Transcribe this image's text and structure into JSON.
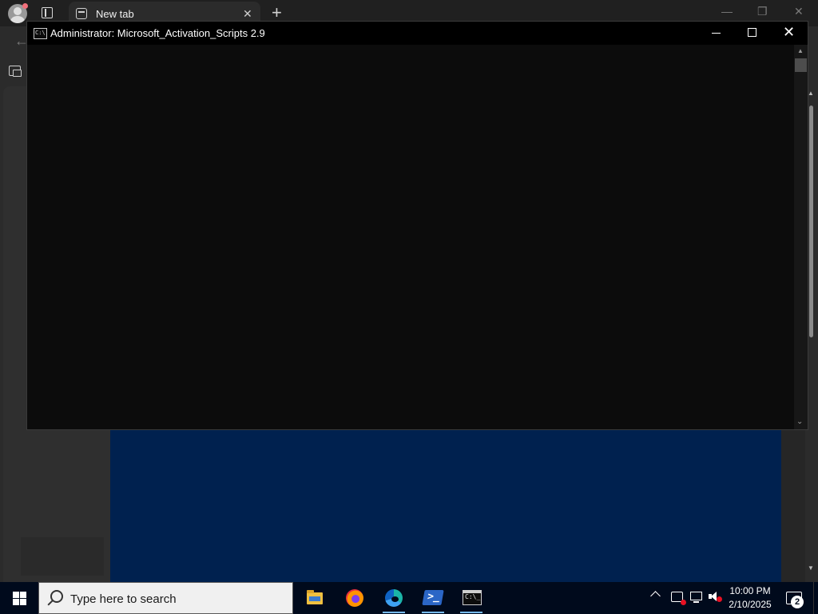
{
  "browser": {
    "tab": {
      "title": "New tab",
      "close_label": "✕"
    },
    "new_tab_label": "+",
    "window_controls": {
      "minimize": "—",
      "restore": "❐",
      "close": "✕"
    },
    "back_label": "←"
  },
  "console": {
    "title": "Administrator:  Microsoft_Activation_Scripts 2.9",
    "icon_text": "C:\\",
    "close_label": "✕"
  },
  "taskbar": {
    "search_placeholder": "Type here to search",
    "apps": [
      {
        "name": "File Explorer",
        "icon": "folder-icon",
        "active": false
      },
      {
        "name": "Firefox",
        "icon": "firefox-icon",
        "active": false
      },
      {
        "name": "Microsoft Edge",
        "icon": "edge-icon",
        "active": true
      },
      {
        "name": "PowerShell",
        "icon": "powershell-icon",
        "active": true
      },
      {
        "name": "Command Prompt",
        "icon": "cmd-icon",
        "active": true
      }
    ],
    "tray": {
      "time": "10:00 PM",
      "date": "2/10/2025",
      "notification_count": "2"
    },
    "accent": "#76b9ed"
  },
  "colors": {
    "page_blue": "#00214f",
    "console_bg": "#0c0c0c",
    "taskbar_bg": "#000a1c"
  }
}
